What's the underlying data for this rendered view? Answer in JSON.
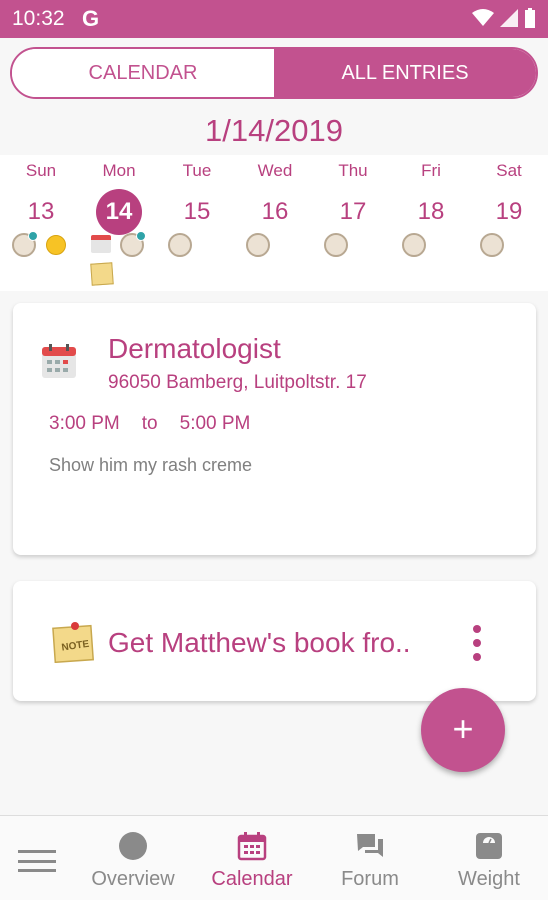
{
  "status_bar": {
    "time": "10:32",
    "g_label": "G"
  },
  "tabs": [
    {
      "label": "CALENDAR",
      "active": false
    },
    {
      "label": "ALL ENTRIES",
      "active": true
    }
  ],
  "selected_date": "1/14/2019",
  "week": [
    {
      "dow": "Sun",
      "num": "13"
    },
    {
      "dow": "Mon",
      "num": "14",
      "selected": true
    },
    {
      "dow": "Tue",
      "num": "15"
    },
    {
      "dow": "Wed",
      "num": "16"
    },
    {
      "dow": "Thu",
      "num": "17"
    },
    {
      "dow": "Fri",
      "num": "18"
    },
    {
      "dow": "Sat",
      "num": "19"
    }
  ],
  "entries": {
    "appointment": {
      "icon": "calendar-icon",
      "title": "Dermatologist",
      "address": "96050 Bamberg, Luitpoltstr. 17",
      "start": "3:00 PM",
      "to": "to",
      "end": "5:00 PM",
      "note": "Show him my rash creme"
    },
    "note": {
      "icon": "sticky-note-icon",
      "title": "Get Matthew's book fro.."
    }
  },
  "fab": {
    "label": "+"
  },
  "nav": {
    "overview": "Overview",
    "calendar": "Calendar",
    "forum": "Forum",
    "weight": "Weight"
  },
  "colors": {
    "accent": "#c2528f",
    "accent_text": "#b8407f"
  }
}
